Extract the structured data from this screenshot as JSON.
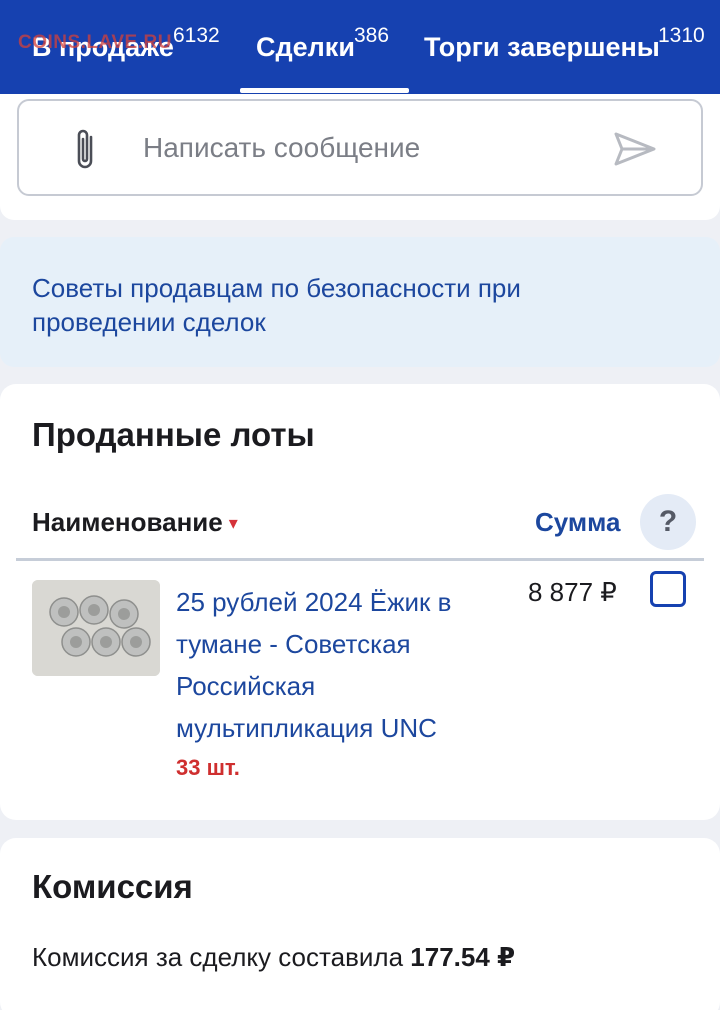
{
  "tabs": [
    {
      "label": "В продаже",
      "count": "6132",
      "active": false
    },
    {
      "label": "Сделки",
      "count": "386",
      "active": true
    },
    {
      "label": "Торги завершены",
      "count": "1310",
      "active": false
    }
  ],
  "watermark": "COINS.LAVE.RU",
  "message": {
    "placeholder": "Написать сообщение",
    "attach_icon": "paperclip-icon",
    "send_icon": "send-icon"
  },
  "tips": {
    "text": "Советы продавцам по безопасности при проведении сделок"
  },
  "sold_lots": {
    "title": "Проданные лоты",
    "columns": {
      "name": "Наименование",
      "sort_indicator": "▾",
      "sum": "Сумма",
      "help": "?"
    },
    "items": [
      {
        "title": "25 рублей 2024 Ёжик в тумане - Советская Российская мультипликация UNC",
        "quantity": "33 шт.",
        "price": "8 877 ₽",
        "checked": false
      }
    ]
  },
  "commission": {
    "title": "Комиссия",
    "text": "Комиссия за сделку составила",
    "amount": "177.54 ₽"
  },
  "colors": {
    "header": "#1641b0",
    "link": "#1c479e",
    "accent_red": "#cf2f2f",
    "tips_bg": "#e6f0f9"
  }
}
